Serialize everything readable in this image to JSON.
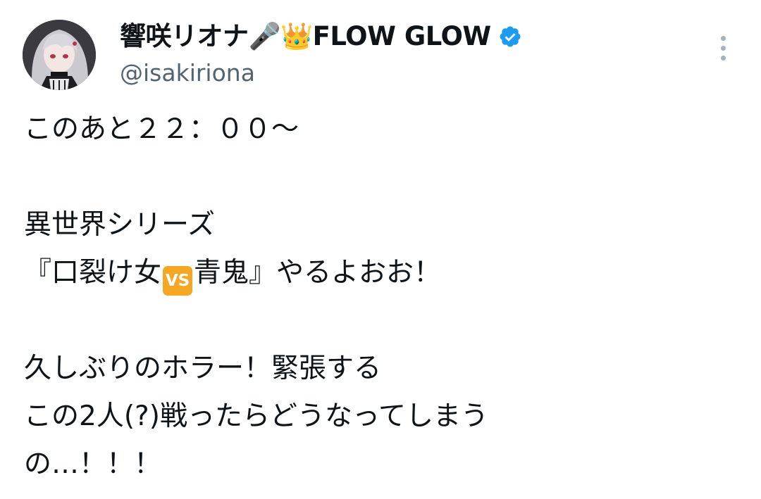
{
  "author": {
    "display_name": "響咲リオナ🎤👑FLOW GLOW",
    "handle": "@isakiriona",
    "verified": true
  },
  "icons": {
    "verified": "verified-badge-icon",
    "more": "more-options-icon",
    "vs": "vs-emoji-icon"
  },
  "colors": {
    "verified_blue": "#1d9bf0",
    "handle_gray": "#536471",
    "vs_orange": "#f5a623"
  },
  "tweet": {
    "line1": "このあと２２：００〜",
    "line2": "異世界シリーズ",
    "line3_before": "『口裂け女",
    "vs_label": "VS",
    "line3_after": "青鬼』やるよおお！",
    "line4": "久しぶりのホラー！緊張する",
    "line5": "この2人(?)戦ったらどうなってしまう",
    "line6": "の…！！！"
  }
}
